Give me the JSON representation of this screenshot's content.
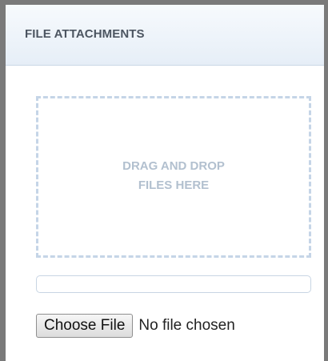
{
  "panel": {
    "title": "FILE ATTACHMENTS"
  },
  "drop_zone": {
    "line1": "DRAG AND DROP",
    "line2": "FILES HERE"
  },
  "upload_progress": {
    "fraction": 0
  },
  "file_input": {
    "button_label": "Choose File",
    "status": "No file chosen"
  },
  "colors": {
    "frame": "#7a7a7a",
    "header_bg": "#e6eef7",
    "title": "#4c5561",
    "drop_border": "#c5d5e7",
    "drop_text": "#b2c0cf"
  }
}
